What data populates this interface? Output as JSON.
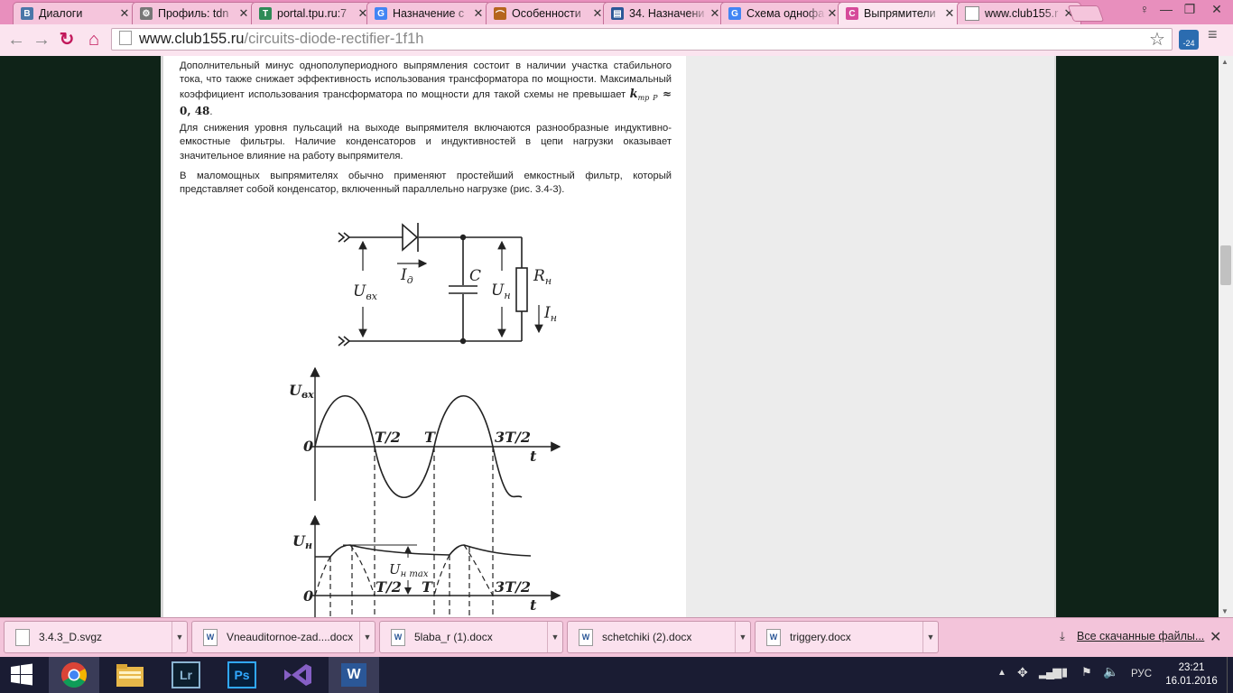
{
  "tabs": [
    {
      "title": "Диалоги",
      "icon": "vk-icon",
      "color": "#4a76a8",
      "glyph": "В"
    },
    {
      "title": "Профиль: tdn",
      "icon": "gear-icon",
      "color": "#777777",
      "glyph": "⚙"
    },
    {
      "title": "portal.tpu.ru:7",
      "icon": "tpu-icon",
      "color": "#2e8b57",
      "glyph": "T"
    },
    {
      "title": "Назначение с",
      "icon": "google-icon",
      "color": "#4285f4",
      "glyph": "G"
    },
    {
      "title": "Особенности",
      "icon": "bridge-icon",
      "color": "#b5651d",
      "glyph": "⌒"
    },
    {
      "title": "34. Назначени",
      "icon": "page-icon",
      "color": "#2b5797",
      "glyph": "▤"
    },
    {
      "title": "Схема однофа",
      "icon": "google-icon",
      "color": "#4285f4",
      "glyph": "G"
    },
    {
      "title": "Выпрямители",
      "icon": "site-icon",
      "color": "#d64a9a",
      "glyph": "C"
    },
    {
      "title": "www.club155.r",
      "icon": "blank-page-icon",
      "color": "#ffffff",
      "glyph": ""
    }
  ],
  "window_buttons": {
    "profile": "♀",
    "minimize": "—",
    "maximize": "❐",
    "close": "✕"
  },
  "toolbar": {
    "back": "←",
    "forward": "→",
    "reload": "↻",
    "home": "⌂",
    "url_domain": "www.club155.ru",
    "url_path": "/circuits-diode-rectifier-1f1h",
    "star": "☆",
    "ext_badge": "-24"
  },
  "article": {
    "para1_text": "Дополнительный минус однополупериодного выпрямления состоит в наличии участка стабильного тока, что также снижает эффективность использования трансформатора по мощности. Максимальный коэффициент использования трансформатора по мощности для такой схемы не превышает ",
    "para1_formula": "k",
    "para1_formula_sub": "тр P",
    "para1_formula_tail": " ≈ 0, 48",
    "para1_end": ".",
    "para2": "Для снижения уровня пульсаций на выходе выпрямителя включаются разнообразные индуктивно-емкостные фильтры. Наличие конденсаторов и индуктивностей в цепи нагрузки оказывает значительное влияние на работу выпрямителя.",
    "para3": "В маломощных выпрямителях обычно применяют простейший емкостный фильтр, который представляет собой конденсатор, включенный параллельно нагрузке (рис. 3.4-3)."
  },
  "circuit": {
    "u_in": "U",
    "u_in_sub": "вх",
    "i_d": "I",
    "i_d_sub": "д",
    "cap": "C",
    "u_load": "U",
    "u_load_sub": "н",
    "r_load": "R",
    "r_load_sub": "н",
    "i_load": "I",
    "i_load_sub": "н"
  },
  "graph1": {
    "y_label": "U",
    "y_sub": "вх",
    "zero": "0",
    "t_half": "T/2",
    "t_full": "T",
    "t_3half": "3T/2",
    "t_axis": "t"
  },
  "graph2": {
    "y_label": "U",
    "y_sub": "н",
    "zero": "0",
    "t_half": "T/2",
    "t_full": "T",
    "t_3half": "3T/2",
    "t_axis": "t",
    "ripple_label": "U",
    "ripple_sub": "н max"
  },
  "downloads": [
    {
      "name": "3.4.3_D.svgz",
      "type": "file"
    },
    {
      "name": "Vneauditornoe-zad....docx",
      "type": "word"
    },
    {
      "name": "5laba_r (1).docx",
      "type": "word"
    },
    {
      "name": "schetchiki (2).docx",
      "type": "word"
    },
    {
      "name": "triggery.docx",
      "type": "word"
    }
  ],
  "all_downloads": "Все скачанные файлы...",
  "taskbar": {
    "apps": [
      "start",
      "chrome",
      "file-explorer",
      "lightroom",
      "photoshop",
      "visual-studio",
      "word"
    ],
    "lr": "Lr",
    "ps": "Ps",
    "w": "W",
    "lang": "РУС",
    "time": "23:21",
    "date": "16.01.2016"
  }
}
